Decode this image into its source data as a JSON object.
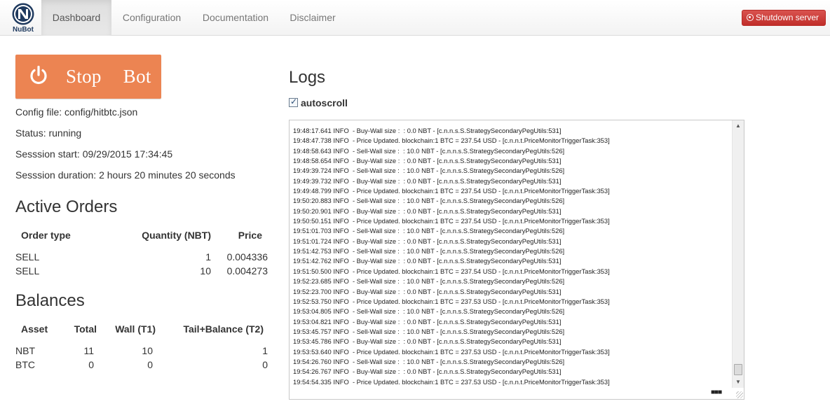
{
  "nav": {
    "brand_text": "NuBot",
    "items": [
      {
        "label": "Dashboard",
        "active": true
      },
      {
        "label": "Configuration",
        "active": false
      },
      {
        "label": "Documentation",
        "active": false
      },
      {
        "label": "Disclaimer",
        "active": false
      }
    ],
    "shutdown_label": "Shutdown server",
    "shutdown_icon": "power-circle-icon"
  },
  "control": {
    "stop_label": "Stop Bot",
    "stop_icon": "power-icon",
    "stop_color": "#ec8452"
  },
  "info": {
    "config_file": "Config file: config/hitbtc.json",
    "status": "Status: running",
    "session_start": "Sesssion start: 09/29/2015 17:34:45",
    "session_duration": "Sesssion duration: 2 hours 20 minutes 20 seconds"
  },
  "orders": {
    "title": "Active Orders",
    "headers": [
      "Order type",
      "Quantity (NBT)",
      "Price"
    ],
    "rows": [
      [
        "SELL",
        "1",
        "0.004336"
      ],
      [
        "SELL",
        "10",
        "0.004273"
      ]
    ]
  },
  "balances": {
    "title": "Balances",
    "headers": [
      "Asset",
      "Total",
      "Wall (T1)",
      "Tail+Balance (T2)"
    ],
    "rows": [
      [
        "NBT",
        "11",
        "10",
        "1"
      ],
      [
        "BTC",
        "0",
        "0",
        "0"
      ]
    ]
  },
  "logs": {
    "title": "Logs",
    "autoscroll_label": "autoscroll",
    "autoscroll_checked": true,
    "lines": [
      "19:48:17.641 INFO  - Buy-Wall size :  : 0.0 NBT - [c.n.n.s.S.StrategySecondaryPegUtils:531]",
      "19:48:47.738 INFO  - Price Updated. blockchain:1 BTC = 237.54 USD - [c.n.n.t.PriceMonitorTriggerTask:353]",
      "19:48:58.643 INFO  - Sell-Wall size :  : 10.0 NBT - [c.n.n.s.S.StrategySecondaryPegUtils:526]",
      "19:48:58.654 INFO  - Buy-Wall size :  : 0.0 NBT - [c.n.n.s.S.StrategySecondaryPegUtils:531]",
      "19:49:39.724 INFO  - Sell-Wall size :  : 10.0 NBT - [c.n.n.s.S.StrategySecondaryPegUtils:526]",
      "19:49:39.732 INFO  - Buy-Wall size :  : 0.0 NBT - [c.n.n.s.S.StrategySecondaryPegUtils:531]",
      "19:49:48.799 INFO  - Price Updated. blockchain:1 BTC = 237.54 USD - [c.n.n.t.PriceMonitorTriggerTask:353]",
      "19:50:20.883 INFO  - Sell-Wall size :  : 10.0 NBT - [c.n.n.s.S.StrategySecondaryPegUtils:526]",
      "19:50:20.901 INFO  - Buy-Wall size :  : 0.0 NBT - [c.n.n.s.S.StrategySecondaryPegUtils:531]",
      "19:50:50.151 INFO  - Price Updated. blockchain:1 BTC = 237.54 USD - [c.n.n.t.PriceMonitorTriggerTask:353]",
      "19:51:01.703 INFO  - Sell-Wall size :  : 10.0 NBT - [c.n.n.s.S.StrategySecondaryPegUtils:526]",
      "19:51:01.724 INFO  - Buy-Wall size :  : 0.0 NBT - [c.n.n.s.S.StrategySecondaryPegUtils:531]",
      "19:51:42.753 INFO  - Sell-Wall size :  : 10.0 NBT - [c.n.n.s.S.StrategySecondaryPegUtils:526]",
      "19:51:42.762 INFO  - Buy-Wall size :  : 0.0 NBT - [c.n.n.s.S.StrategySecondaryPegUtils:531]",
      "19:51:50.500 INFO  - Price Updated. blockchain:1 BTC = 237.54 USD - [c.n.n.t.PriceMonitorTriggerTask:353]",
      "19:52:23.685 INFO  - Sell-Wall size :  : 10.0 NBT - [c.n.n.s.S.StrategySecondaryPegUtils:526]",
      "19:52:23.700 INFO  - Buy-Wall size :  : 0.0 NBT - [c.n.n.s.S.StrategySecondaryPegUtils:531]",
      "19:52:53.750 INFO  - Price Updated. blockchain:1 BTC = 237.53 USD - [c.n.n.t.PriceMonitorTriggerTask:353]",
      "19:53:04.805 INFO  - Sell-Wall size :  : 10.0 NBT - [c.n.n.s.S.StrategySecondaryPegUtils:526]",
      "19:53:04.821 INFO  - Buy-Wall size :  : 0.0 NBT - [c.n.n.s.S.StrategySecondaryPegUtils:531]",
      "19:53:45.757 INFO  - Sell-Wall size :  : 10.0 NBT - [c.n.n.s.S.StrategySecondaryPegUtils:526]",
      "19:53:45.786 INFO  - Buy-Wall size :  : 0.0 NBT - [c.n.n.s.S.StrategySecondaryPegUtils:531]",
      "19:53:53.640 INFO  - Price Updated. blockchain:1 BTC = 237.53 USD - [c.n.n.t.PriceMonitorTriggerTask:353]",
      "19:54:26.760 INFO  - Sell-Wall size :  : 10.0 NBT - [c.n.n.s.S.StrategySecondaryPegUtils:526]",
      "19:54:26.767 INFO  - Buy-Wall size :  : 0.0 NBT - [c.n.n.s.S.StrategySecondaryPegUtils:531]",
      "19:54:54.335 INFO  - Price Updated. blockchain:1 BTC = 237.53 USD - [c.n.n.t.PriceMonitorTriggerTask:353]"
    ]
  }
}
